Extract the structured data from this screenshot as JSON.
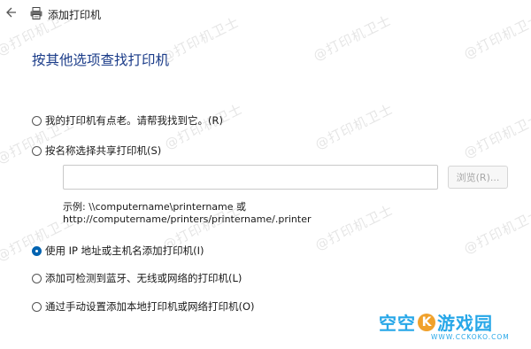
{
  "window": {
    "title": "添加打印机",
    "back_icon": "back-arrow-icon",
    "window_icon": "printer-icon"
  },
  "page_title": "按其他选项查找打印机",
  "options": {
    "old_printer": {
      "label": "我的打印机有点老。请帮我找到它。(R)",
      "checked": false
    },
    "shared_by_name": {
      "label": "按名称选择共享打印机(S)",
      "checked": false
    },
    "tcpip": {
      "label": "使用 IP 地址或主机名添加打印机(I)",
      "checked": true
    },
    "bluetooth_wireless": {
      "label": "添加可检测到蓝牙、无线或网络的打印机(L)",
      "checked": false
    },
    "manual": {
      "label": "通过手动设置添加本地打印机或网络打印机(O)",
      "checked": false
    }
  },
  "shared_printer": {
    "input_value": "",
    "browse_label": "浏览(R)...",
    "example_line1": "示例: \\\\computername\\printername 或",
    "example_line2": "http://computername/printers/printername/.printer"
  },
  "watermark": {
    "text": "@打印机卫士"
  },
  "brand": {
    "name_left": "空空",
    "logo_letter": "K",
    "name_right": "游戏园",
    "url": "WWW.CCKOKO.COM"
  },
  "colors": {
    "title_blue": "#1b3c89",
    "radio_selected": "#0063b1",
    "brand_blue": "#27a7e8",
    "brand_orange": "#f0a12b"
  }
}
